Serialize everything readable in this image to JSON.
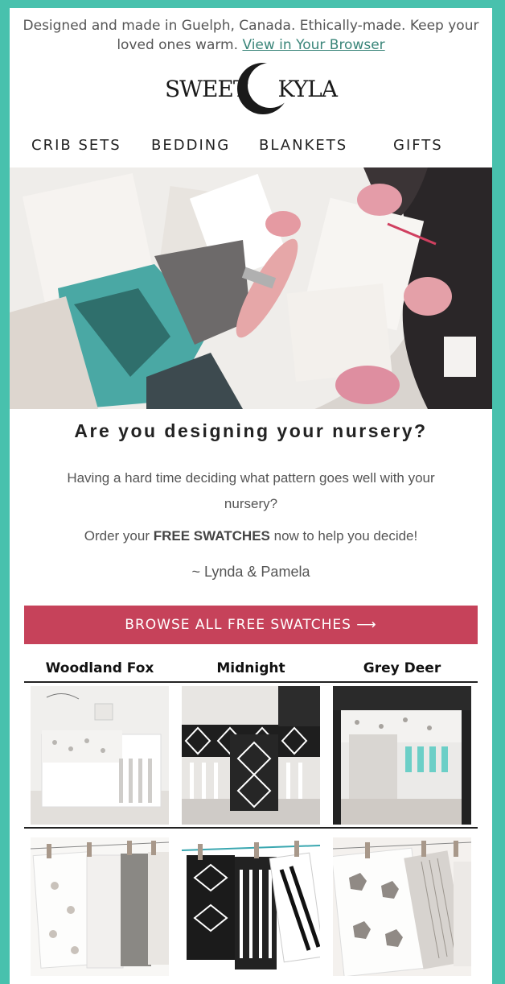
{
  "preheader": {
    "text": "Designed and made in Guelph, Canada. Ethically-made. Keep your loved ones warm.",
    "link": "View in Your Browser"
  },
  "logo": {
    "left": "SWEET",
    "right": "KYLA"
  },
  "nav": {
    "items": [
      "CRIB SETS",
      "BEDDING",
      "BLANKETS",
      "GIFTS"
    ]
  },
  "headline": "Are you designing your nursery?",
  "body": {
    "line1": "Having a hard time deciding what pattern goes well with your nursery?",
    "line2_pre": "Order your",
    "line2_bold": "FREE SWATCHES",
    "line2_post": "now to help you decide!",
    "signature": "~ Lynda & Pamela"
  },
  "cta": {
    "label": "BROWSE ALL FREE SWATCHES ⟶"
  },
  "products": [
    {
      "name": "Woodland Fox"
    },
    {
      "name": "Midnight"
    },
    {
      "name": "Grey Deer"
    }
  ],
  "colors": {
    "frame": "#48c1ad",
    "cta": "#c6425a",
    "link": "#3a8579"
  }
}
